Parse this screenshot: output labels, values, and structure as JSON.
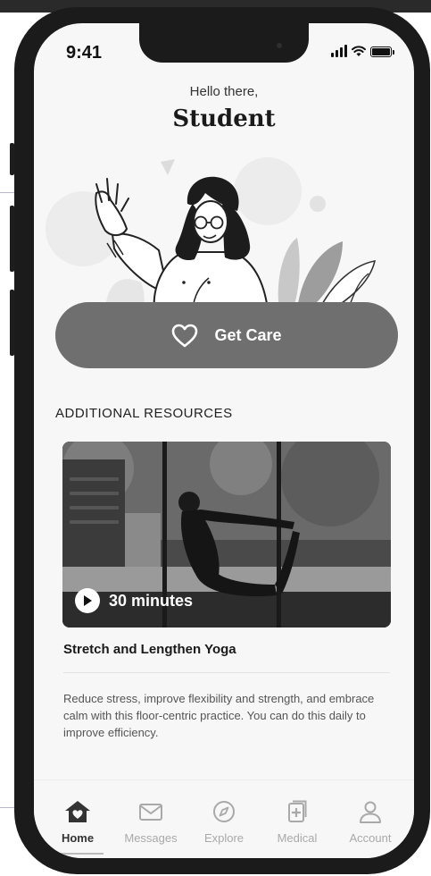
{
  "status": {
    "time": "9:41"
  },
  "greeting": {
    "line1": "Hello there,",
    "name": "Student"
  },
  "get_care": {
    "label": "Get Care",
    "icon": "heart-outline-icon"
  },
  "resources": {
    "title": "ADDITIONAL RESOURCES",
    "card": {
      "duration": "30 minutes",
      "title": "Stretch and Lengthen Yoga",
      "description": "Reduce stress, improve flexibility and strength, and embrace calm with this floor-centric practice. You can do this daily to improve efficiency."
    }
  },
  "tabs": [
    {
      "label": "Home",
      "icon": "home-heart-icon",
      "active": true
    },
    {
      "label": "Messages",
      "icon": "envelope-icon",
      "active": false
    },
    {
      "label": "Explore",
      "icon": "compass-icon",
      "active": false
    },
    {
      "label": "Medical",
      "icon": "medical-doc-icon",
      "active": false
    },
    {
      "label": "Account",
      "icon": "person-icon",
      "active": false
    }
  ],
  "colors": {
    "button": "#6f6f6f",
    "active_tab": "#333333",
    "inactive_tab": "#a9a9a9"
  }
}
